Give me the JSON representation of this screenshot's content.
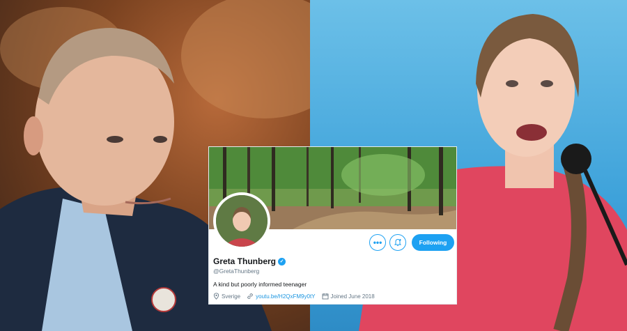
{
  "profile": {
    "display_name": "Greta Thunberg",
    "handle": "@GretaThunberg",
    "bio": "A kind but poorly informed teenager",
    "location": "Sverige",
    "website": "youtu.be/H2QxFM9y0tY",
    "joined": "Joined June 2018",
    "follow_label": "Following",
    "more_label": "•••",
    "verified_mark": "✓"
  },
  "icons": {
    "more": "more-icon",
    "notifications": "bell-plus-icon",
    "location": "location-pin-icon",
    "link": "link-icon",
    "calendar": "calendar-icon"
  },
  "colors": {
    "accent": "#1da1f2",
    "link": "#1b95e0",
    "secondary_text": "#657786"
  }
}
